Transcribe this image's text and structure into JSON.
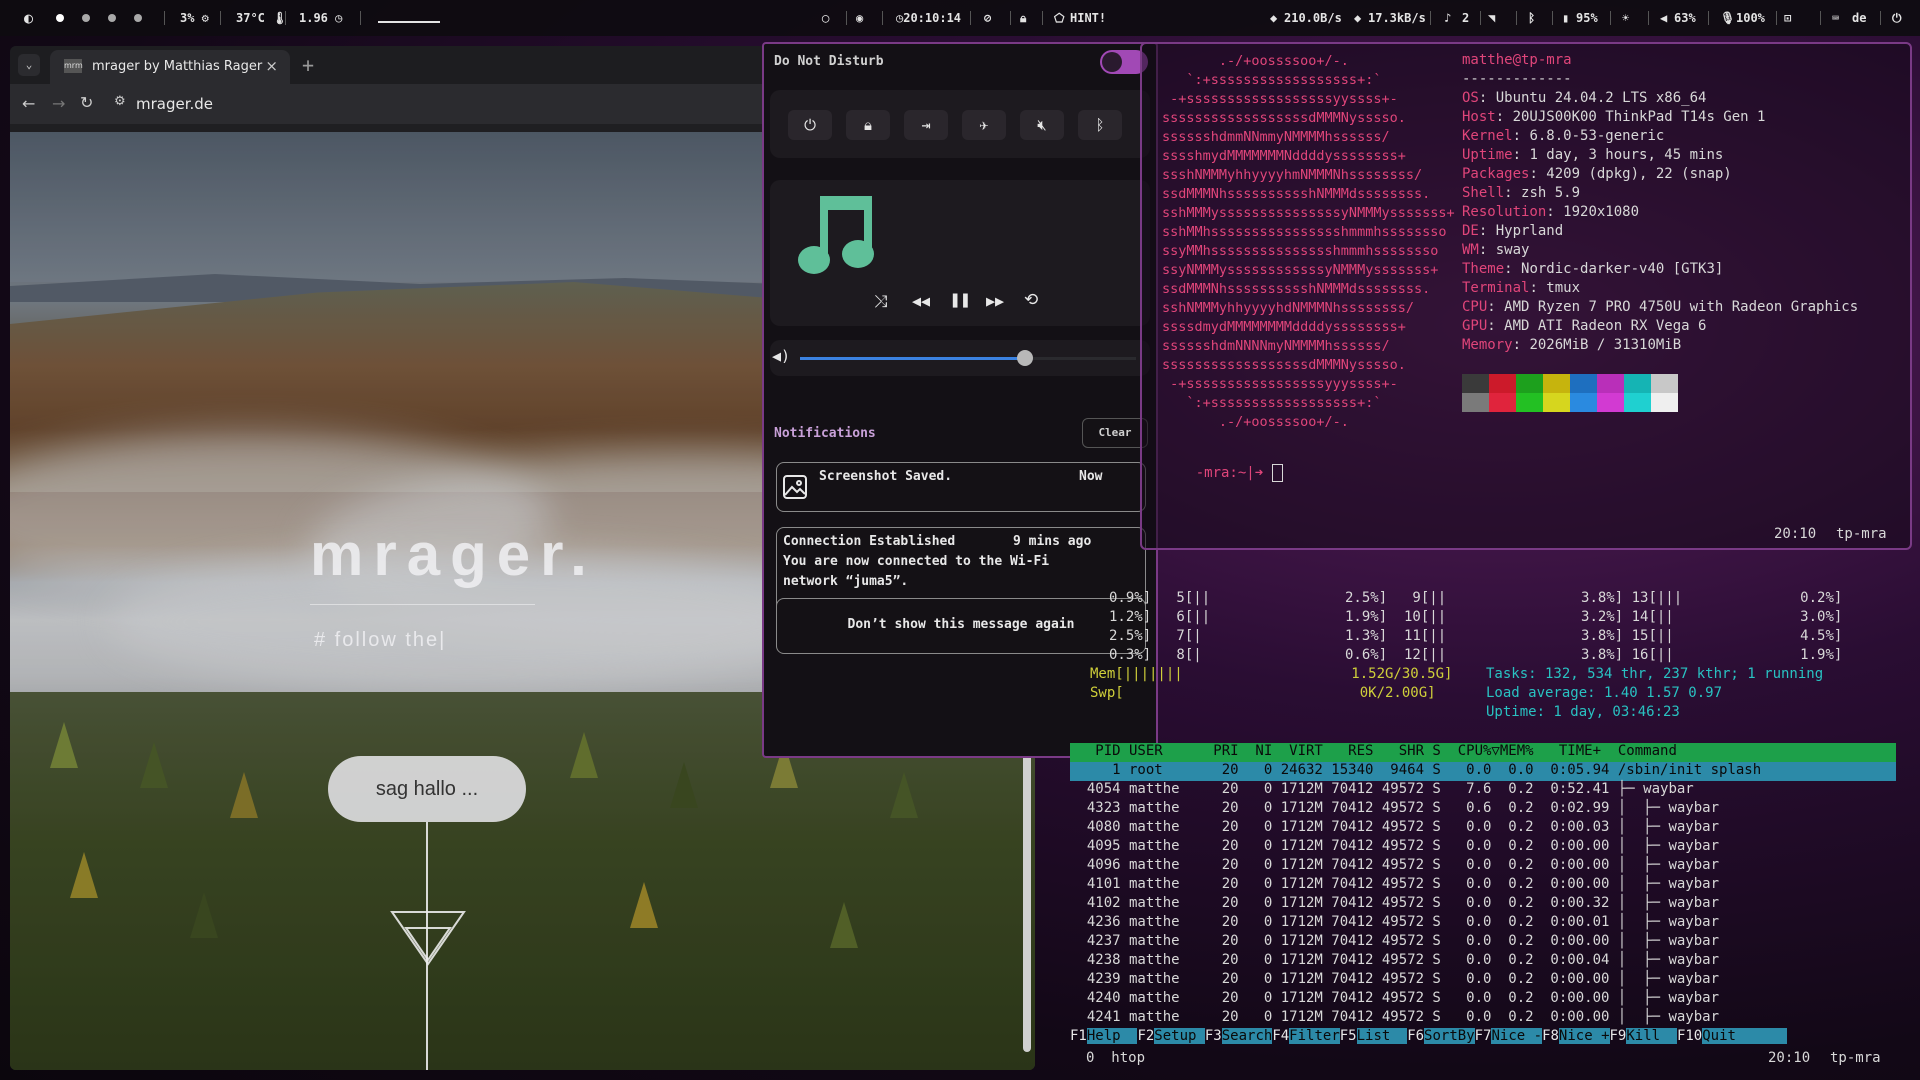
{
  "topbar": {
    "cpu": "3% ⚙",
    "temp": "37°C 🌡",
    "load": "1.96 ◷",
    "clock": "◷20:10:14",
    "hint": "HINT!",
    "net_down": "210.0B/s",
    "net_up": "17.3kB/s",
    "notif_count": "2",
    "battery": "95%",
    "volume": "63%",
    "mic": "100%",
    "keyboard_layout": "de"
  },
  "browser": {
    "tab_title": "mrager by Matthias Rager",
    "favicon": "mrm",
    "url": "mrager.de",
    "site": {
      "title": "mrager.",
      "subtitle": "# follow the|",
      "cta": "sag hallo ..."
    }
  },
  "control_center": {
    "dnd_label": "Do Not Disturb",
    "dnd_on": true,
    "quick_buttons": [
      "power-icon",
      "lock-icon",
      "logout-icon",
      "airplane-icon",
      "mute-icon",
      "bluetooth-icon"
    ],
    "volume_level": 0.67,
    "notifications_label": "Notifications",
    "clear_label": "Clear",
    "notifications": [
      {
        "title": "Screenshot Saved.",
        "time": "Now"
      },
      {
        "title": "Connection Established",
        "time": "9 mins ago",
        "body_line1": "You are now connected to the Wi-Fi",
        "body_line2": "network “juma5”."
      }
    ],
    "dont_show_label": "Don’t show this message again"
  },
  "terminal": {
    "user_host": "matthe@tp-mra",
    "underline": "-------------",
    "info": [
      {
        "k": "OS",
        "v": "Ubuntu 24.04.2 LTS x86_64"
      },
      {
        "k": "Host",
        "v": "20UJS00K00 ThinkPad T14s Gen 1"
      },
      {
        "k": "Kernel",
        "v": "6.8.0-53-generic"
      },
      {
        "k": "Uptime",
        "v": "1 day, 3 hours, 45 mins"
      },
      {
        "k": "Packages",
        "v": "4209 (dpkg), 22 (snap)"
      },
      {
        "k": "Shell",
        "v": "zsh 5.9"
      },
      {
        "k": "Resolution",
        "v": "1920x1080"
      },
      {
        "k": "DE",
        "v": "Hyprland"
      },
      {
        "k": "WM",
        "v": "sway"
      },
      {
        "k": "Theme",
        "v": "Nordic-darker-v40 [GTK3]"
      },
      {
        "k": "Terminal",
        "v": "tmux"
      },
      {
        "k": "CPU",
        "v": "AMD Ryzen 7 PRO 4750U with Radeon Graphics"
      },
      {
        "k": "GPU",
        "v": "AMD ATI Radeon RX Vega 6"
      },
      {
        "k": "Memory",
        "v": "2026MiB / 31310MiB"
      }
    ],
    "ascii": [
      "       .-/+oossssoo+/-.",
      "   `:+ssssssssssssssssss+:`",
      " -+ssssssssssssssssssyyssss+-",
      "ssssssssssssssssssdMMMNysssso.",
      "sssssshdmmNNmmyNMMMMhssssss/",
      "sssshmydMMMMMMMNddddyssssssss+",
      "ssshNMMMyhhyyyyhmNMMMNhssssssss/",
      "ssdMMMNhsssssssssshNMMMdssssssss.",
      "sshMMMysssssssssssssssyNMMMysssssss+",
      "sshMMhsssssssssssssssshmmmhssssssso",
      "ssyMMhssssssssssssssshmmmhssssssso",
      "ssyNMMMyssssssssssssyNMMMysssssss+",
      "ssdMMMNhsssssssssshNMMMdssssssss.",
      "sshNMMMyhhyyyyhdNMMMNhssssssss/",
      "ssssdmydMMMMMMMMddddyssssssss+",
      "sssssshdmNNNNmyNMMMMhssssss/",
      "ssssssssssssssssssdMMMNysssso.",
      " -+sssssssssssssssssyyyssss+-",
      "   `:+ssssssssssssssssss+:`",
      "       .-/+oossssoo+/-."
    ],
    "prompt": "-mra:~|➜ ",
    "status_time": "20:10",
    "status_host": "tp-mra",
    "palette_top": [
      "#3a3a3a",
      "#cc1a2a",
      "#1da01d",
      "#c6b40d",
      "#1e6fbf",
      "#b92fb9",
      "#15b4b4",
      "#c8c8c8"
    ],
    "palette_bottom": [
      "#7a7a7a",
      "#e0243c",
      "#23c023",
      "#d6d61e",
      "#2a8ae0",
      "#d23ad2",
      "#1fd0d0",
      "#efefef"
    ]
  },
  "htop": {
    "cpu_rows": [
      "       0.9%]   5[||                2.5%]   9[||                3.8%] 13[|||              0.2%]",
      "       1.2%]   6[||                1.9%]  10[||                3.2%] 14[||               3.0%]",
      "       2.5%]   7[|                 1.3%]  11[||                3.8%] 15[||               4.5%]",
      "       0.3%]   8[|                 0.6%]  12[||                3.8%] 16[||               1.9%]"
    ],
    "mem_line": "Mem[|||||||                    1.52G/30.5G]",
    "swp_line": "Swp[                            0K/2.00G]",
    "tasks": "Tasks: 132, 534 thr, 237 kthr; 1 running",
    "load": "Load average: 1.40 1.57 0.97",
    "uptime": "Uptime: 1 day, 03:46:23",
    "header": "   PID USER      PRI  NI  VIRT   RES   SHR S  CPU%▽MEM%   TIME+  Command",
    "root_row": "     1 root       20   0 24632 15340  9464 S   0.0  0.0  0:05.94 /sbin/init splash",
    "rows": [
      "  4054 matthe     20   0 1712M 70412 49572 S   7.6  0.2  0:52.41 ├─ waybar",
      "  4323 matthe     20   0 1712M 70412 49572 S   0.6  0.2  0:02.99 │  ├─ waybar",
      "  4080 matthe     20   0 1712M 70412 49572 S   0.0  0.2  0:00.03 │  ├─ waybar",
      "  4095 matthe     20   0 1712M 70412 49572 S   0.0  0.2  0:00.00 │  ├─ waybar",
      "  4096 matthe     20   0 1712M 70412 49572 S   0.0  0.2  0:00.00 │  ├─ waybar",
      "  4101 matthe     20   0 1712M 70412 49572 S   0.0  0.2  0:00.00 │  ├─ waybar",
      "  4102 matthe     20   0 1712M 70412 49572 S   0.0  0.2  0:00.32 │  ├─ waybar",
      "  4236 matthe     20   0 1712M 70412 49572 S   0.0  0.2  0:00.01 │  ├─ waybar",
      "  4237 matthe     20   0 1712M 70412 49572 S   0.0  0.2  0:00.00 │  ├─ waybar",
      "  4238 matthe     20   0 1712M 70412 49572 S   0.0  0.2  0:00.04 │  ├─ waybar",
      "  4239 matthe     20   0 1712M 70412 49572 S   0.0  0.2  0:00.00 │  ├─ waybar",
      "  4240 matthe     20   0 1712M 70412 49572 S   0.0  0.2  0:00.00 │  ├─ waybar",
      "  4241 matthe     20   0 1712M 70412 49572 S   0.0  0.2  0:00.00 │  ├─ waybar"
    ],
    "fkeys": [
      {
        "n": "F1",
        "l": "Help  "
      },
      {
        "n": "F2",
        "l": "Setup "
      },
      {
        "n": "F3",
        "l": "Search"
      },
      {
        "n": "F4",
        "l": "Filter"
      },
      {
        "n": "F5",
        "l": "List  "
      },
      {
        "n": "F6",
        "l": "SortBy"
      },
      {
        "n": "F7",
        "l": "Nice -"
      },
      {
        "n": "F8",
        "l": "Nice +"
      },
      {
        "n": "F9",
        "l": "Kill  "
      },
      {
        "n": "F10",
        "l": "Quit      "
      }
    ],
    "tmux_window": "0  htop",
    "tmux_time": "20:10",
    "tmux_host": "tp-mra"
  }
}
